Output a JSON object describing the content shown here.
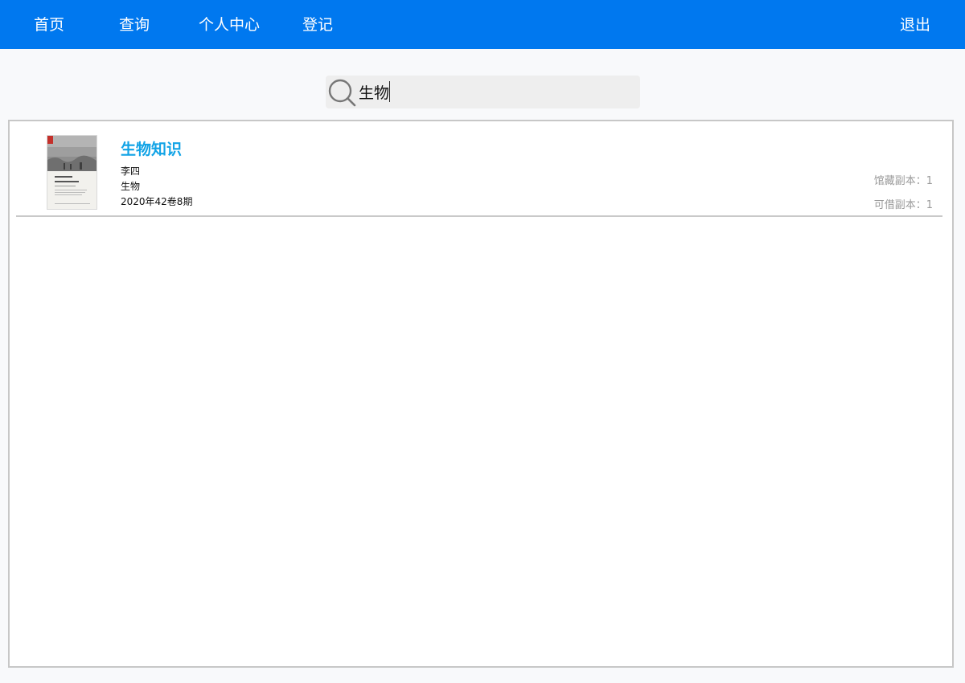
{
  "nav": {
    "items": [
      {
        "label": "首页"
      },
      {
        "label": "查询"
      },
      {
        "label": "个人中心"
      },
      {
        "label": "登记"
      }
    ],
    "logout_label": "退出"
  },
  "search": {
    "value": "生物",
    "icon": "search-icon"
  },
  "results": [
    {
      "title": "生物知识",
      "author": "李四",
      "category": "生物",
      "issue": "2020年42卷8期",
      "holdings_label": "馆藏副本：",
      "holdings_count": "1",
      "available_label": "可借副本：",
      "available_count": "1",
      "cover": {
        "icon": "book-cover-image",
        "accent_color": "#c4302b"
      }
    }
  ],
  "colors": {
    "topbar": "#0078ef",
    "title_link": "#11a3e6",
    "muted_text": "#9a9a9a"
  }
}
